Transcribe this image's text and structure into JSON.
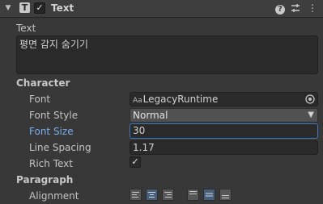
{
  "component": {
    "title": "Text",
    "component_icon": "T",
    "enabled_icon": "checkmark-icon",
    "icons": [
      "foldout-arrow-icon",
      "help-icon",
      "presets-icon",
      "context-menu-icon"
    ]
  },
  "text": {
    "label": "Text",
    "value": "평면 감지 숨기기"
  },
  "character": {
    "heading": "Character",
    "font_label": "Font",
    "font_icon": "Aa",
    "font_value": "LegacyRuntime",
    "font_style_label": "Font Style",
    "font_style_value": "Normal",
    "font_size_label": "Font Size",
    "font_size_value": "30",
    "line_spacing_label": "Line Spacing",
    "line_spacing_value": "1.17",
    "rich_text_label": "Rich Text",
    "rich_text_checked": true
  },
  "paragraph": {
    "heading": "Paragraph",
    "alignment_label": "Alignment",
    "horizontal_selected": "center",
    "vertical_selected": "middle"
  },
  "colors": {
    "background": "#383838",
    "field": "#2a2a2a",
    "focus_border": "#3a79bb",
    "active_label": "#7badec",
    "selected_button": "#46607c"
  }
}
